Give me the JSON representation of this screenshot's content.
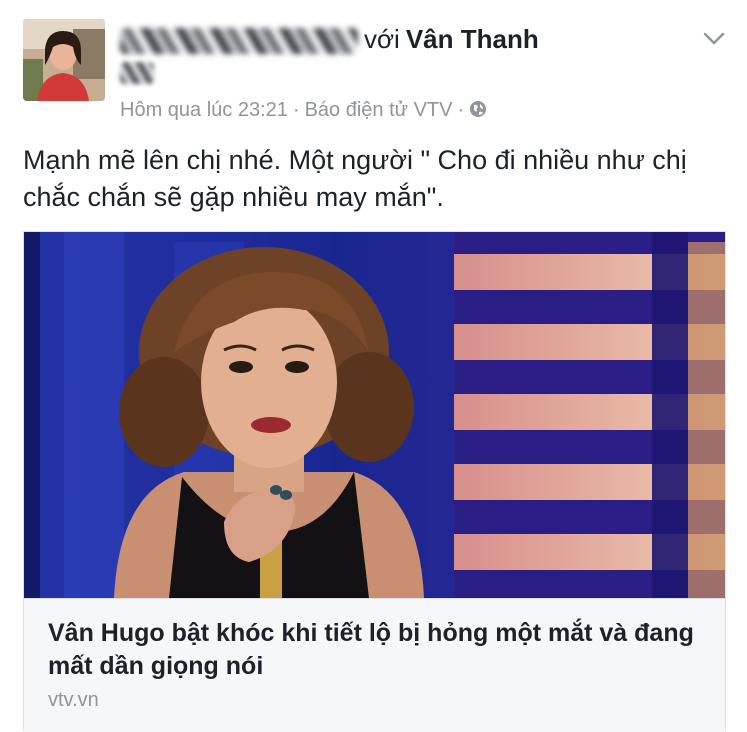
{
  "post": {
    "header_with": "với",
    "header_tagged_name": "Vân Thanh",
    "meta_time": "Hôm qua lúc 23:21",
    "meta_separator": "·",
    "meta_via": "Báo điện tử VTV",
    "privacy_icon": "globe-icon",
    "menu_icon": "chevron-down-icon",
    "text": "Mạnh mẽ lên chị nhé. Một người \" Cho đi nhiều như chị chắc chắn sẽ gặp nhiều may mắn\"."
  },
  "link_card": {
    "title": "Vân Hugo bật khóc khi tiết lộ bị hỏng một mắt và đang mất dần giọng nói",
    "source": "vtv.vn"
  },
  "colors": {
    "text_primary": "#1d2129",
    "text_secondary": "#90949c",
    "card_footer_bg": "#f6f7f9",
    "stage_blue": "#1d2a8a"
  }
}
